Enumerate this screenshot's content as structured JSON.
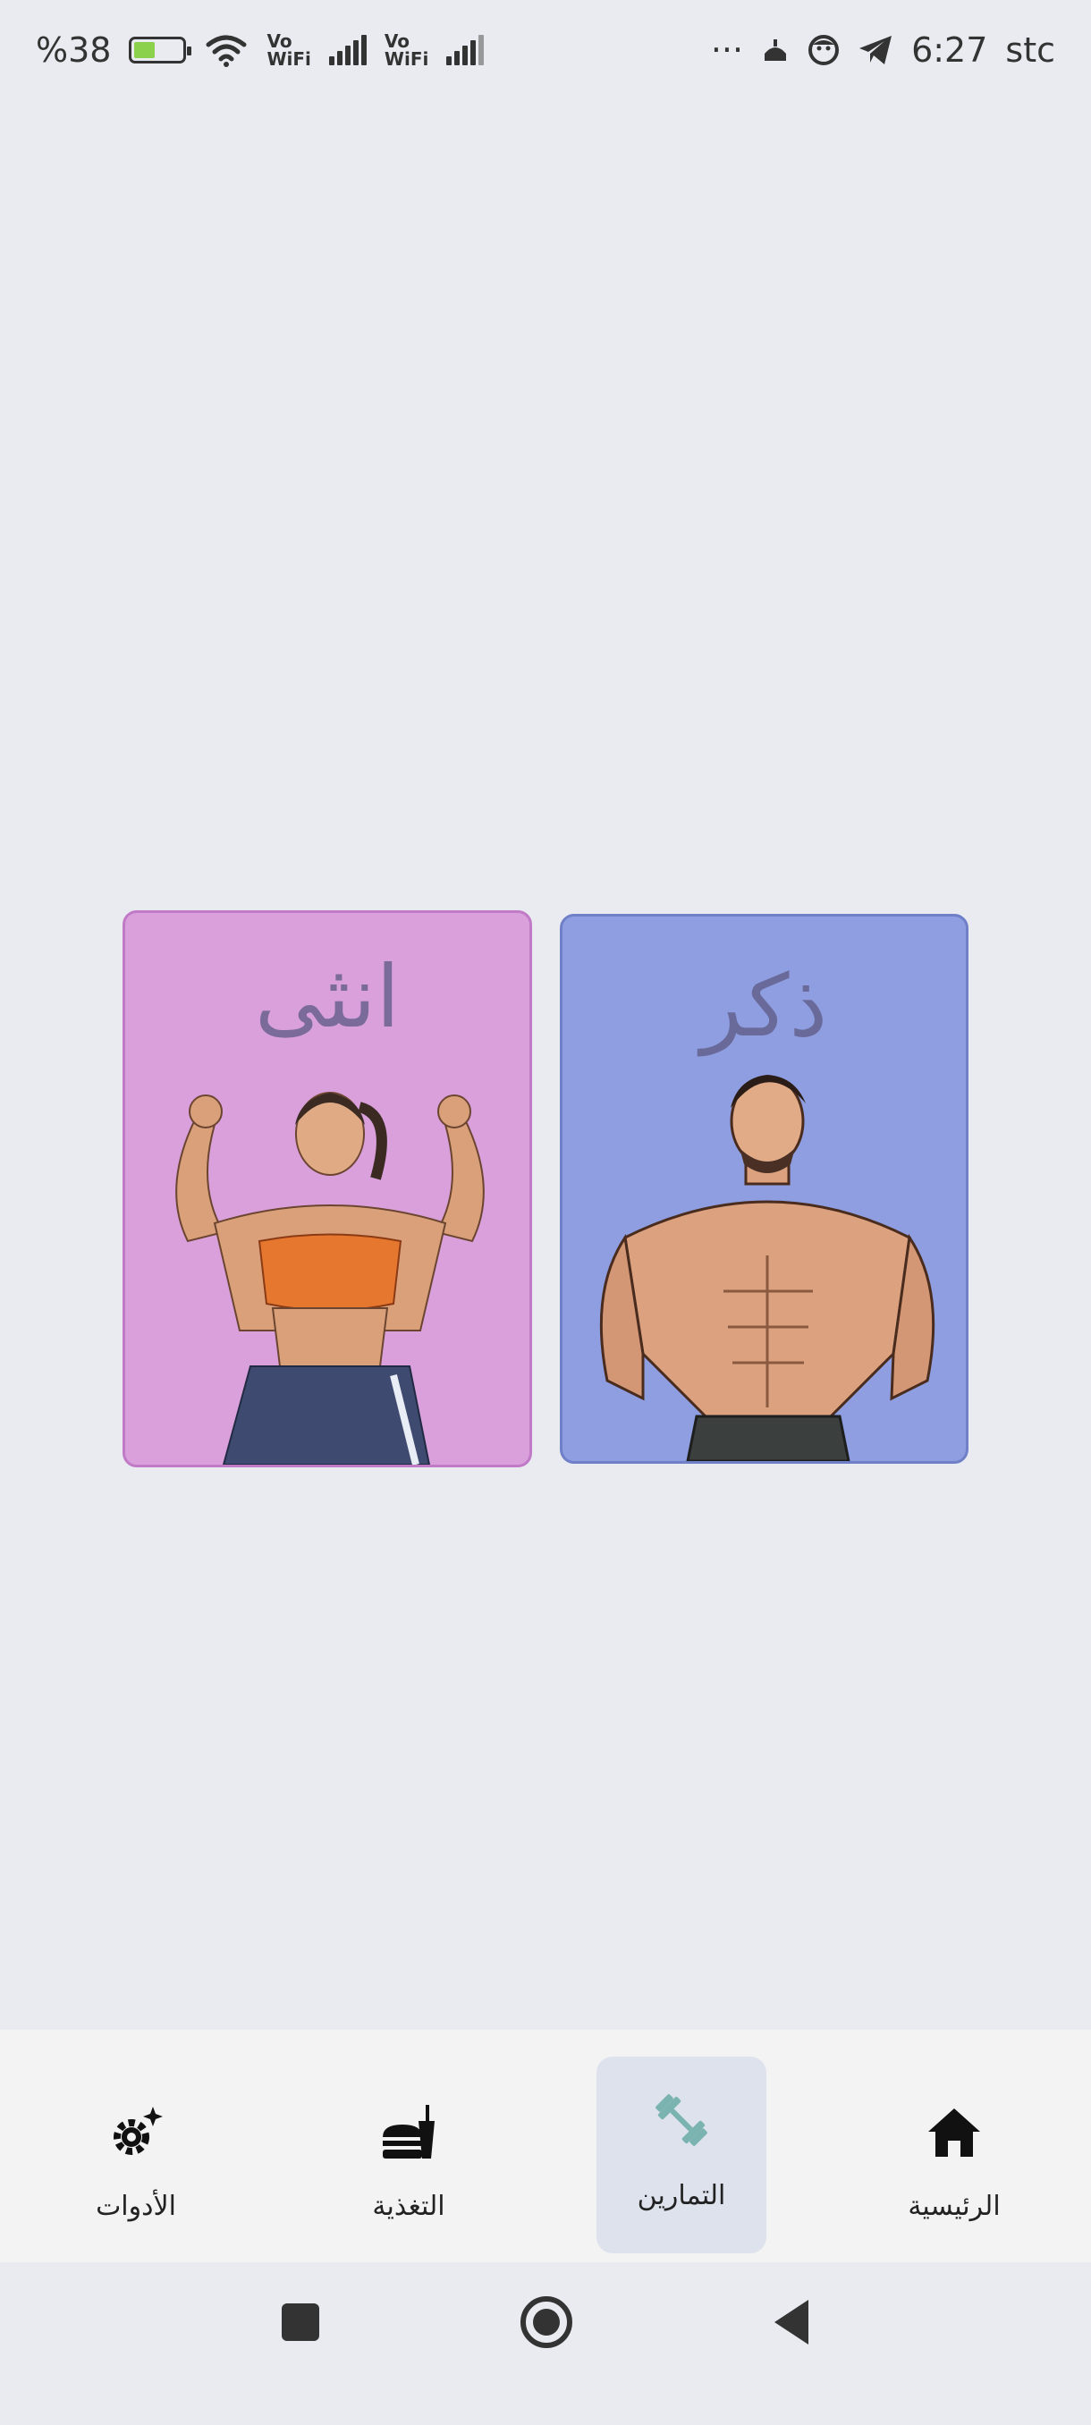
{
  "status_bar": {
    "battery_text": "%38",
    "wifi_label_1": "Vo\nWiFi",
    "wifi_label_2": "Vo\nWiFi",
    "overflow": "···",
    "time": "6:27",
    "carrier": "stc"
  },
  "cards": [
    {
      "id": "female",
      "label": "انثى",
      "color": "#d9a0dc"
    },
    {
      "id": "male",
      "label": "ذكر",
      "color": "#8e9ee0"
    }
  ],
  "bottom_nav": {
    "items": [
      {
        "id": "tools",
        "label": "الأدوات",
        "icon": "gear-sparkle-icon"
      },
      {
        "id": "nutrition",
        "label": "التغذية",
        "icon": "food-icon"
      },
      {
        "id": "exercises",
        "label": "التمارين",
        "icon": "dumbbell-icon",
        "active": true
      },
      {
        "id": "home",
        "label": "الرئيسية",
        "icon": "home-icon"
      }
    ]
  },
  "colors": {
    "background": "#e9ebf0",
    "nav_active": "#dde2ec",
    "dumbbell": "#7bb3b0"
  }
}
